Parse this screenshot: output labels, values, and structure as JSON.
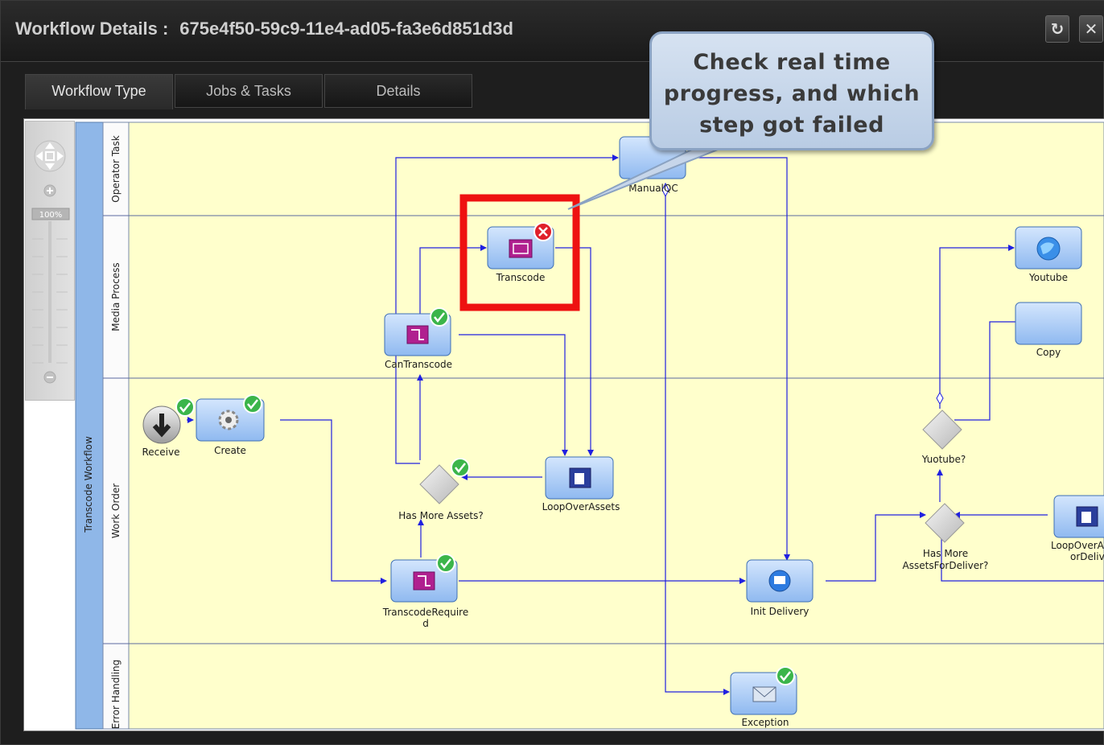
{
  "window": {
    "title_prefix": "Workflow Details :",
    "workflow_id": "675e4f50-59c9-11e4-ad05-fa3e6d851d3d",
    "refresh_icon": "refresh-icon",
    "close_icon": "close-icon"
  },
  "tabs": [
    {
      "label": "Workflow Type",
      "active": true
    },
    {
      "label": "Jobs & Tasks",
      "active": false
    },
    {
      "label": "Details",
      "active": false
    }
  ],
  "zoom": {
    "level": "100%"
  },
  "callout": {
    "text": "Check real time\nprogress, and which\nstep got failed"
  },
  "pool": {
    "label": "Transcode Workflow"
  },
  "lanes": [
    "Operator Task",
    "Media Process",
    "Work Order",
    "Error Handling"
  ],
  "nodes": {
    "receive": {
      "label": "Receive",
      "status": "success"
    },
    "create": {
      "label": "Create",
      "status": "success"
    },
    "manualqc": {
      "label": "ManualQC"
    },
    "transcode": {
      "label": "Transcode",
      "status": "failed"
    },
    "cantranscode": {
      "label": "CanTranscode",
      "status": "success"
    },
    "hasmoreassets": {
      "label": "Has More Assets?",
      "status": "success"
    },
    "loopoverassets": {
      "label": "LoopOverAssets"
    },
    "transcoderequired": {
      "label_line1": "TranscodeRequire",
      "label_line2": "d",
      "status": "success"
    },
    "initdelivery": {
      "label": "Init Delivery"
    },
    "exception": {
      "label": "Exception",
      "status": "success"
    },
    "youtube": {
      "label": "Youtube"
    },
    "copy": {
      "label": "Copy"
    },
    "yuotube_gw": {
      "label": "Yuotube?"
    },
    "hasmoreassetsfordeliver": {
      "label_line1": "Has More",
      "label_line2": "AssetsForDeliver?"
    },
    "loopoverassetsfordeliver": {
      "label_line1": "LoopOverA",
      "label_line2": "orDeliv"
    }
  },
  "colors": {
    "lane_bg": "#ffffcc",
    "task_fill": "#a9cbf5",
    "connector": "#2020e0",
    "success": "#3bb54a",
    "failed": "#e0202a",
    "highlight": "#ee1111",
    "pool_band": "#8fb7e8"
  }
}
